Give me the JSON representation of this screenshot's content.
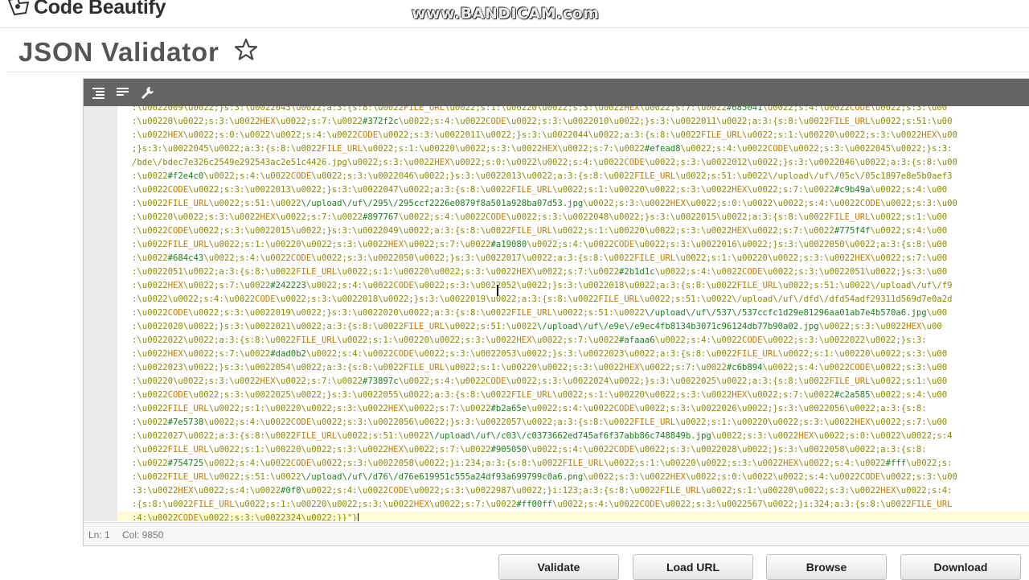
{
  "header": {
    "logo_text": "Code Beautify",
    "watermark": "www.BANDICAM.com"
  },
  "page": {
    "title": "JSON Validator",
    "favorite_icon": "star-outline-icon"
  },
  "editor": {
    "toolbar": {
      "icons": [
        "format-icon",
        "compact-icon",
        "wrench-icon"
      ]
    },
    "code_lines": [
      ":\\u0022009\\u0022;}s:3:\\u0022043\\u0022;a:3:{s:8:\\u0022FILE_URL\\u0022;s:1:\\u00220\\u0022;s:3:\\u0022HEX\\u0022;s:7:\\u0022#685041\\u0022;s:4:\\u0022CODE\\u0022;s:3:\\u00",
      ":\\u00220\\u0022;s:3:\\u0022HEX\\u0022;s:7:\\u0022#372f2c\\u0022;s:4:\\u0022CODE\\u0022;s:3:\\u0022010\\u0022;}s:3:\\u0022011\\u0022;a:3:{s:8:\\u0022FILE_URL\\u0022;s:51:\\u00",
      ":\\u0022HEX\\u0022;s:0:\\u0022\\u0022;s:4:\\u0022CODE\\u0022;s:3:\\u0022011\\u0022;}s:3:\\u0022044\\u0022;a:3:{s:8:\\u0022FILE_URL\\u0022;s:1:\\u00220\\u0022;s:3:\\u0022HEX\\u00",
      ";}s:3:\\u0022045\\u0022;a:3:{s:8:\\u0022FILE_URL\\u0022;s:1:\\u00220\\u0022;s:3:\\u0022HEX\\u0022;s:7:\\u0022#efead8\\u0022;s:4:\\u0022CODE\\u0022;s:3:\\u0022045\\u0022;}s:3:",
      "/bde\\/bdec7e326c2549e292543ac2e51c4426.jpg\\u0022;s:3:\\u0022HEX\\u0022;s:0:\\u0022\\u0022;s:4:\\u0022CODE\\u0022;s:3:\\u0022012\\u0022;}s:3:\\u0022046\\u0022;a:3:{s:8:\\u00",
      ":\\u0022#f2e4c0\\u0022;s:4:\\u0022CODE\\u0022;s:3:\\u0022046\\u0022;}s:3:\\u0022013\\u0022;a:3:{s:8:\\u0022FILE_URL\\u0022;s:51:\\u0022\\/upload\\/uf\\/05c\\/05c1897e8e5b0aef3",
      ":\\u0022CODE\\u0022;s:3:\\u0022013\\u0022;}s:3:\\u0022047\\u0022;a:3:{s:8:\\u0022FILE_URL\\u0022;s:1:\\u00220\\u0022;s:3:\\u0022HEX\\u0022;s:7:\\u0022#c9b49a\\u0022;s:4:\\u00",
      ":\\u0022FILE_URL\\u0022;s:51:\\u0022\\/upload\\/uf\\/295\\/295ccf2226e0879f8a501a928ba07d53.jpg\\u0022;s:3:\\u0022HEX\\u0022;s:0:\\u0022\\u0022;s:4:\\u0022CODE\\u0022;s:3:\\u00",
      ":\\u00220\\u0022;s:3:\\u0022HEX\\u0022;s:7:\\u0022#897767\\u0022;s:4:\\u0022CODE\\u0022;s:3:\\u0022048\\u0022;}s:3:\\u0022015\\u0022;a:3:{s:8:\\u0022FILE_URL\\u0022;s:1:\\u00",
      ":\\u0022CODE\\u0022;s:3:\\u0022015\\u0022;}s:3:\\u0022049\\u0022;a:3:{s:8:\\u0022FILE_URL\\u0022;s:1:\\u00220\\u0022;s:3:\\u0022HEX\\u0022;s:7:\\u0022#775f4f\\u0022;s:4:\\u00",
      ":\\u0022FILE_URL\\u0022;s:1:\\u00220\\u0022;s:3:\\u0022HEX\\u0022;s:7:\\u0022#a19080\\u0022;s:4:\\u0022CODE\\u0022;s:3:\\u0022016\\u0022;}s:3:\\u0022050\\u0022;a:3:{s:8:\\u00",
      ":\\u0022#684c43\\u0022;s:4:\\u0022CODE\\u0022;s:3:\\u0022050\\u0022;}s:3:\\u0022017\\u0022;a:3:{s:8:\\u0022FILE_URL\\u0022;s:1:\\u00220\\u0022;s:3:\\u0022HEX\\u0022;s:7:\\u00",
      ":\\u0022051\\u0022;a:3:{s:8:\\u0022FILE_URL\\u0022;s:1:\\u00220\\u0022;s:3:\\u0022HEX\\u0022;s:7:\\u0022#2b1d1c\\u0022;s:4:\\u0022CODE\\u0022;s:3:\\u0022051\\u0022;}s:3:\\u00",
      ":\\u0022HEX\\u0022;s:7:\\u0022#242223\\u0022;s:4:\\u0022CODE\\u0022;s:3:\\u0022052\\u0022;}s:3:\\u0022018\\u0022;a:3:{s:8:\\u0022FILE_URL\\u0022;s:51:\\u0022\\/upload\\/uf\\/f9",
      ":\\u0022\\u0022;s:4:\\u0022CODE\\u0022;s:3:\\u0022018\\u0022;}s:3:\\u0022019\\u0022;a:3:{s:8:\\u0022FILE_URL\\u0022;s:51:\\u0022\\/upload\\/uf\\/dfd\\/dfd54adf29311d569d7e0a2d",
      ":\\u0022CODE\\u0022;s:3:\\u0022019\\u0022;}s:3:\\u0022020\\u0022;a:3:{s:8:\\u0022FILE_URL\\u0022;s:51:\\u0022\\/upload\\/uf\\/537\\/537ccfc1d29e81296aa01ab7e4b570a6.jpg\\u00",
      ":\\u0022020\\u0022;}s:3:\\u0022021\\u0022;a:3:{s:8:\\u0022FILE_URL\\u0022;s:51:\\u0022\\/upload\\/uf\\/e9e\\/e9ec4fb8134b3071c96124db77b90a02.jpg\\u0022;s:3:\\u0022HEX\\u00",
      ":\\u0022022\\u0022;a:3:{s:8:\\u0022FILE_URL\\u0022;s:1:\\u00220\\u0022;s:3:\\u0022HEX\\u0022;s:7:\\u0022#afaaa6\\u0022;s:4:\\u0022CODE\\u0022;s:3:\\u0022022\\u0022;}s:3:",
      ":\\u0022HEX\\u0022;s:7:\\u0022#dad0b2\\u0022;s:4:\\u0022CODE\\u0022;s:3:\\u0022053\\u0022;}s:3:\\u0022023\\u0022;a:3:{s:8:\\u0022FILE_URL\\u0022;s:1:\\u00220\\u0022;s:3:\\u00",
      ":\\u0022023\\u0022;}s:3:\\u0022054\\u0022;a:3:{s:8:\\u0022FILE_URL\\u0022;s:1:\\u00220\\u0022;s:3:\\u0022HEX\\u0022;s:7:\\u0022#c6b894\\u0022;s:4:\\u0022CODE\\u0022;s:3:\\u00",
      ":\\u00220\\u0022;s:3:\\u0022HEX\\u0022;s:7:\\u0022#73897c\\u0022;s:4:\\u0022CODE\\u0022;s:3:\\u0022024\\u0022;}s:3:\\u0022025\\u0022;a:3:{s:8:\\u0022FILE_URL\\u0022;s:1:\\u00",
      ":\\u0022CODE\\u0022;s:3:\\u0022025\\u0022;}s:3:\\u0022055\\u0022;a:3:{s:8:\\u0022FILE_URL\\u0022;s:1:\\u00220\\u0022;s:3:\\u0022HEX\\u0022;s:7:\\u0022#c2a585\\u0022;s:4:\\u00",
      ":\\u0022FILE_URL\\u0022;s:1:\\u00220\\u0022;s:3:\\u0022HEX\\u0022;s:7:\\u0022#b2a65e\\u0022;s:4:\\u0022CODE\\u0022;s:3:\\u0022026\\u0022;}s:3:\\u0022056\\u0022;a:3:{s:8:",
      ":\\u0022#7e5738\\u0022;s:4:\\u0022CODE\\u0022;s:3:\\u0022056\\u0022;}s:3:\\u0022057\\u0022;a:3:{s:8:\\u0022FILE_URL\\u0022;s:1:\\u00220\\u0022;s:3:\\u0022HEX\\u0022;s:7:\\u00",
      ":\\u0022027\\u0022;a:3:{s:8:\\u0022FILE_URL\\u0022;s:51:\\u0022\\/upload\\/uf\\/c03\\/c0373662ed745af6f37abb86c748849b.jpg\\u0022;s:3:\\u0022HEX\\u0022;s:0:\\u0022\\u0022;s:4",
      ":\\u0022FILE_URL\\u0022;s:1:\\u00220\\u0022;s:3:\\u0022HEX\\u0022;s:7:\\u0022#905050\\u0022;s:4:\\u0022CODE\\u0022;s:3:\\u0022028\\u0022;}s:3:\\u0022058\\u0022;a:3:{s:8:",
      ":\\u0022#754725\\u0022;s:4:\\u0022CODE\\u0022;s:3:\\u0022058\\u0022;}i:234;a:3:{s:8:\\u0022FILE_URL\\u0022;s:1:\\u00220\\u0022;s:3:\\u0022HEX\\u0022;s:4:\\u0022#fff\\u0022;s:",
      ":\\u0022FILE_URL\\u0022;s:51:\\u0022\\/upload\\/uf\\/d76\\/d76e619951c555a24df93a699799c0a6.png\\u0022;s:3:\\u0022HEX\\u0022;s:0:\\u0022\\u0022;s:4:\\u0022CODE\\u0022;s:3:\\u00",
      ":3:\\u0022HEX\\u0022;s:4:\\u0022#0f0\\u0022;s:4:\\u0022CODE\\u0022;s:3:\\u0022987\\u0022;}i:123;a:3:{s:8:\\u0022FILE_URL\\u0022;s:1:\\u00220\\u0022;s:3:\\u0022HEX\\u0022;s:4:",
      ":{s:8:\\u0022FILE_URL\\u0022;s:1:\\u00220\\u0022;s:3:\\u0022HEX\\u0022;s:7:\\u0022#ff00ff\\u0022;s:4:\\u0022CODE\\u0022;s:3:\\u0022567\\u0022;}i:324;a:3:{s:8:\\u0022FILE_URL",
      ":4:\\u0022CODE\\u0022;s:3:\\u0022324\\u0022;}}\"}"
    ],
    "status": {
      "line": "Ln: 1",
      "col": "Col: 9850"
    }
  },
  "actions": {
    "validate": "Validate",
    "load_url": "Load URL",
    "browse": "Browse",
    "download": "Download"
  },
  "colors": {
    "toolbar_bg": "#646464",
    "gutter_bg": "#ebebeb",
    "active_line": "#fffbd6",
    "string": "#1a7f1a",
    "keyword": "#c27a00"
  }
}
